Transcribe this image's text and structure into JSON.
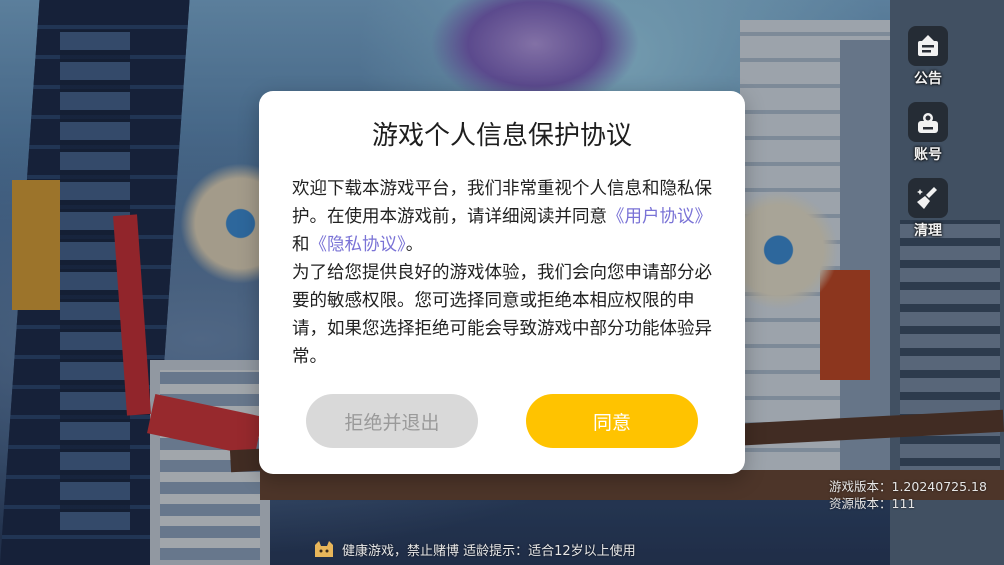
{
  "dialog": {
    "title": "游戏个人信息保护协议",
    "p1_text_a": "欢迎下载本游戏平台，我们非常重视个人信息和隐私保护。在使用本游戏前，请详细阅读并同意",
    "user_agreement_link": "《用户协议》",
    "conjunction": "和",
    "privacy_link": "《隐私协议》",
    "p1_end": "。",
    "p2_text": "为了给您提供良好的游戏体验，我们会向您申请部分必要的敏感权限。您可选择同意或拒绝本相应权限的申请，如果您选择拒绝可能会导致游戏中部分功能体验异常。",
    "decline_label": "拒绝并退出",
    "agree_label": "同意"
  },
  "side_menu": {
    "items": [
      {
        "label": "公告",
        "icon": "announcement-icon"
      },
      {
        "label": "账号",
        "icon": "account-icon"
      },
      {
        "label": "清理",
        "icon": "broom-icon"
      }
    ]
  },
  "version": {
    "game_version": "游戏版本：1.20240725.18",
    "resource_version": "资源版本：111"
  },
  "footer": {
    "notice": "健康游戏，禁止赌博 适龄提示：适合12岁以上使用"
  },
  "colors": {
    "agree_button": "#ffc300",
    "decline_button": "#d9d9d9",
    "link": "#7a73d6"
  }
}
